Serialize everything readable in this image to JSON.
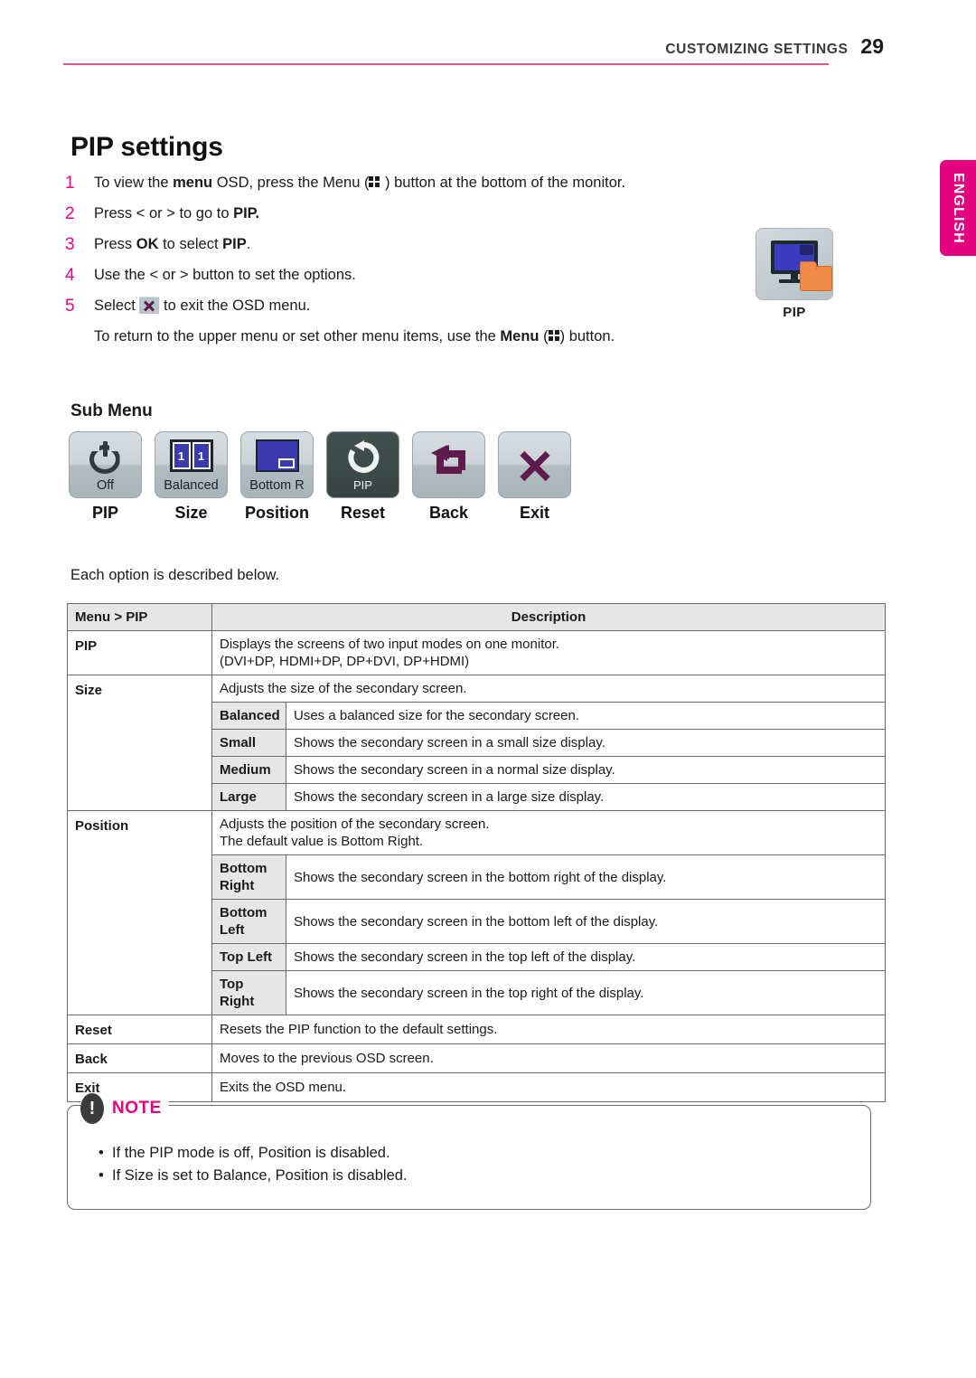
{
  "header": {
    "section_title": "CUSTOMIZING SETTINGS",
    "page_number": "29",
    "rule_color": "#e8508f"
  },
  "language_tab": {
    "label": "ENGLISH",
    "color": "#e4007f"
  },
  "title": "PIP settings",
  "steps": [
    {
      "num": "1",
      "parts": [
        {
          "t": "To view the ",
          "b": false
        },
        {
          "t": "menu",
          "b": true
        },
        {
          "t": " OSD, press the Menu (",
          "b": false
        },
        {
          "icon": "menu-grid-icon"
        },
        {
          "t": " ) button at the bottom of the monitor.",
          "b": false
        }
      ]
    },
    {
      "num": "2",
      "parts": [
        {
          "t": "Press < or > to go to ",
          "b": false
        },
        {
          "t": "PIP.",
          "b": true
        }
      ]
    },
    {
      "num": "3",
      "parts": [
        {
          "t": "Press ",
          "b": false
        },
        {
          "t": "OK",
          "b": true
        },
        {
          "t": " to select ",
          "b": false
        },
        {
          "t": "PIP",
          "b": true
        },
        {
          "t": ".",
          "b": false
        }
      ]
    },
    {
      "num": "4",
      "parts": [
        {
          "t": "Use the < or > button to set the options.",
          "b": false
        }
      ]
    },
    {
      "num": "5",
      "parts": [
        {
          "t": "Select ",
          "b": false
        },
        {
          "icon": "exit-x-icon"
        },
        {
          "t": " to exit the OSD menu.",
          "b": false
        }
      ]
    }
  ],
  "step_continuation": [
    {
      "t": "To return to the upper menu or set other menu items, use the ",
      "b": false
    },
    {
      "t": "Menu",
      "b": true
    },
    {
      "t": " (",
      "b": false
    },
    {
      "icon": "menu-grid-icon"
    },
    {
      "t": ") button.",
      "b": false
    }
  ],
  "pip_illustration": {
    "label": "PIP",
    "icon": "monitor-pip-folder-icon"
  },
  "submenu": {
    "heading": "Sub Menu",
    "items": [
      {
        "label": "PIP",
        "caption": "Off",
        "icon": "power-icon",
        "dark": false
      },
      {
        "label": "Size",
        "caption": "Balanced",
        "icon": "split-panes-icon",
        "dark": false
      },
      {
        "label": "Position",
        "caption": "Bottom R",
        "icon": "pip-position-icon",
        "dark": false
      },
      {
        "label": "Reset",
        "caption": "PIP",
        "icon": "reset-arrow-icon",
        "dark": true
      },
      {
        "label": "Back",
        "caption": "",
        "icon": "back-arrow-icon",
        "dark": false
      },
      {
        "label": "Exit",
        "caption": "",
        "icon": "close-x-icon",
        "dark": false
      }
    ]
  },
  "table_intro": "Each option is described below.",
  "table": {
    "headers": [
      "Menu > PIP",
      "Description"
    ],
    "rows": [
      {
        "key": "PIP",
        "desc": "Displays the screens of two input modes on one monitor.\n(DVI+DP, HDMI+DP, DP+DVI, DP+HDMI)",
        "sub": []
      },
      {
        "key": "Size",
        "desc": "Adjusts the size of the secondary screen.",
        "sub": [
          {
            "name": "Balanced",
            "desc": "Uses a balanced size for the secondary screen."
          },
          {
            "name": "Small",
            "desc": "Shows the secondary screen in a small size display."
          },
          {
            "name": "Medium",
            "desc": "Shows the secondary screen in a normal size display."
          },
          {
            "name": "Large",
            "desc": "Shows the secondary screen in a large size display."
          }
        ]
      },
      {
        "key": "Position",
        "desc": "Adjusts the position of the secondary screen.\nThe default value is Bottom Right.",
        "sub": [
          {
            "name": "Bottom\nRight",
            "desc": "Shows the secondary screen in the bottom right of the display."
          },
          {
            "name": "Bottom\nLeft",
            "desc": "Shows the secondary screen in the bottom left of the display."
          },
          {
            "name": "Top Left",
            "desc": "Shows the secondary screen in the top left of the display."
          },
          {
            "name": "Top\nRight",
            "desc": "Shows the secondary screen in the top right of the display."
          }
        ]
      },
      {
        "key": "Reset",
        "desc": "Resets the PIP function to the default settings.",
        "sub": []
      },
      {
        "key": "Back",
        "desc": "Moves to the previous OSD screen.",
        "sub": []
      },
      {
        "key": "Exit",
        "desc": "Exits the OSD menu.",
        "sub": []
      }
    ]
  },
  "note": {
    "title": "NOTE",
    "icon": "exclamation-icon",
    "items": [
      "If the PIP mode is off, Position is disabled.",
      "If Size is set to Balance, Position is disabled."
    ]
  }
}
